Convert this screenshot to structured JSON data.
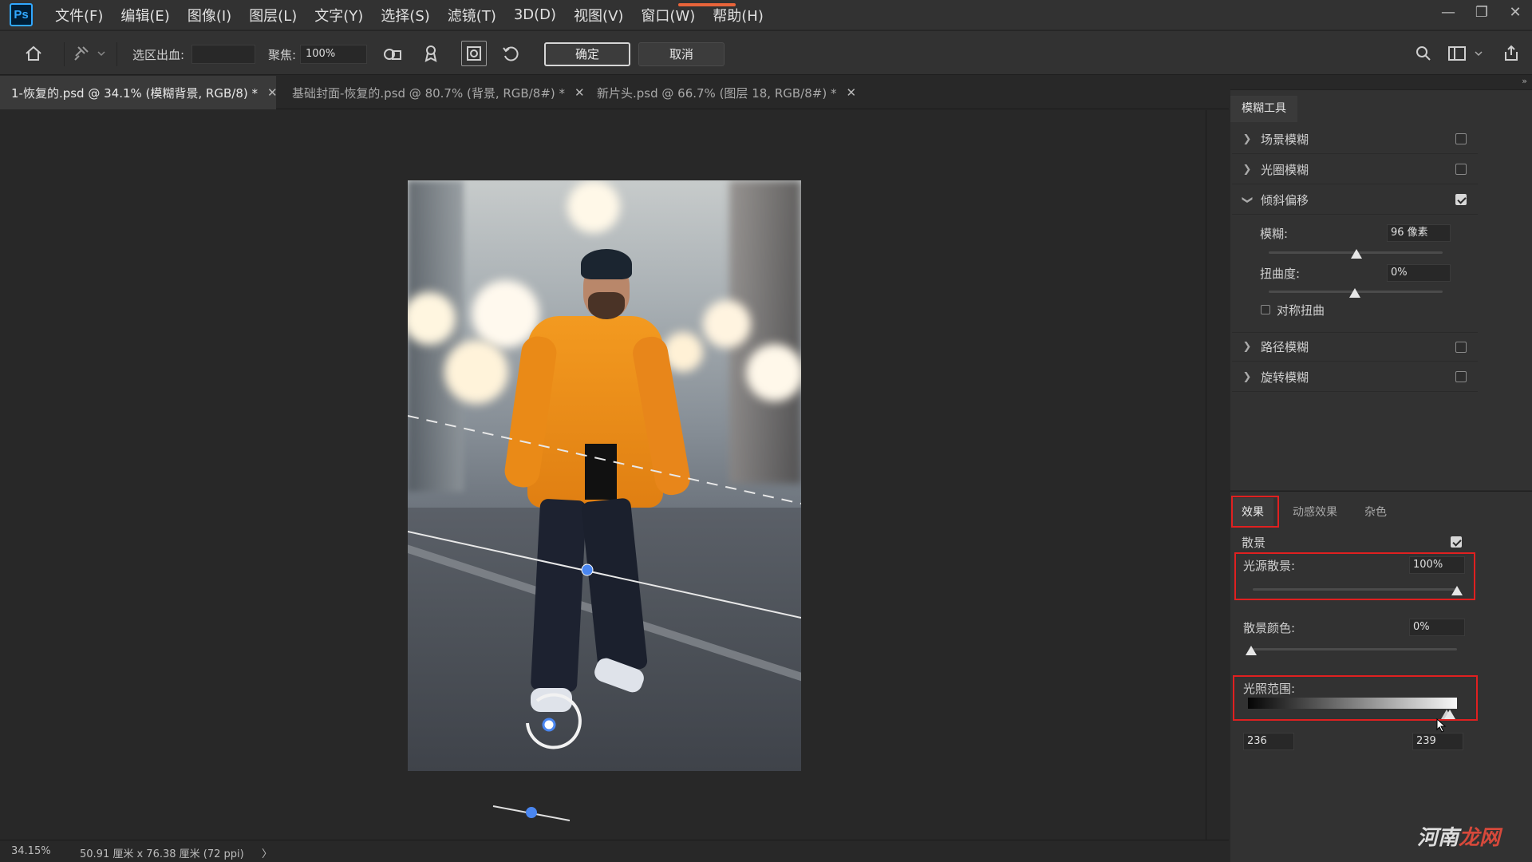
{
  "menu": {
    "logo": "Ps",
    "items": [
      "文件(F)",
      "编辑(E)",
      "图像(I)",
      "图层(L)",
      "文字(Y)",
      "选择(S)",
      "滤镜(T)",
      "3D(D)",
      "视图(V)",
      "窗口(W)",
      "帮助(H)"
    ]
  },
  "options": {
    "selection_output_label": "选区出血:",
    "selection_output_value": "",
    "focus_label": "聚焦:",
    "focus_value": "100%",
    "ok_label": "确定",
    "cancel_label": "取消"
  },
  "tabs": [
    {
      "label": "1-恢复的.psd @ 34.1% (模糊背景, RGB/8) *",
      "active": true
    },
    {
      "label": "基础封面-恢复的.psd @ 80.7% (背景, RGB/8#) *",
      "active": false
    },
    {
      "label": "新片头.psd @ 66.7% (图层 18, RGB/8#) *",
      "active": false
    }
  ],
  "blur_tools": {
    "title": "模糊工具",
    "items": [
      {
        "label": "场景模糊",
        "checked": false,
        "expanded": false
      },
      {
        "label": "光圈模糊",
        "checked": false,
        "expanded": false
      },
      {
        "label": "倾斜偏移",
        "checked": true,
        "expanded": true
      },
      {
        "label": "路径模糊",
        "checked": false,
        "expanded": false
      },
      {
        "label": "旋转模糊",
        "checked": false,
        "expanded": false
      }
    ],
    "tilt_shift": {
      "blur_label": "模糊:",
      "blur_value": "96 像素",
      "blur_level": 0.5,
      "distortion_label": "扭曲度:",
      "distortion_value": "0%",
      "distortion_level": 0.5,
      "symmetric_label": "对称扭曲",
      "symmetric_checked": false
    }
  },
  "effects": {
    "tabs": [
      "效果",
      "动感效果",
      "杂色"
    ],
    "active_tab": "效果",
    "bokeh_label": "散景",
    "bokeh_checked": true,
    "light_bokeh_label": "光源散景:",
    "light_bokeh_value": "100%",
    "light_bokeh_level": 1.0,
    "bokeh_color_label": "散景颜色:",
    "bokeh_color_value": "0%",
    "bokeh_color_level": 0.0,
    "light_range_label": "光照范围:",
    "light_range_low": "236",
    "light_range_high": "239"
  },
  "status": {
    "zoom": "34.15%",
    "doc_size": "50.91 厘米 x 76.38 厘米 (72 ppi)",
    "arrow": "〉"
  },
  "watermark": {
    "text_a": "河南",
    "text_b": "龙网"
  },
  "colors": {
    "accent": "#31a8ff",
    "highlight_box": "#e02020",
    "pin": "#4a86f0"
  }
}
